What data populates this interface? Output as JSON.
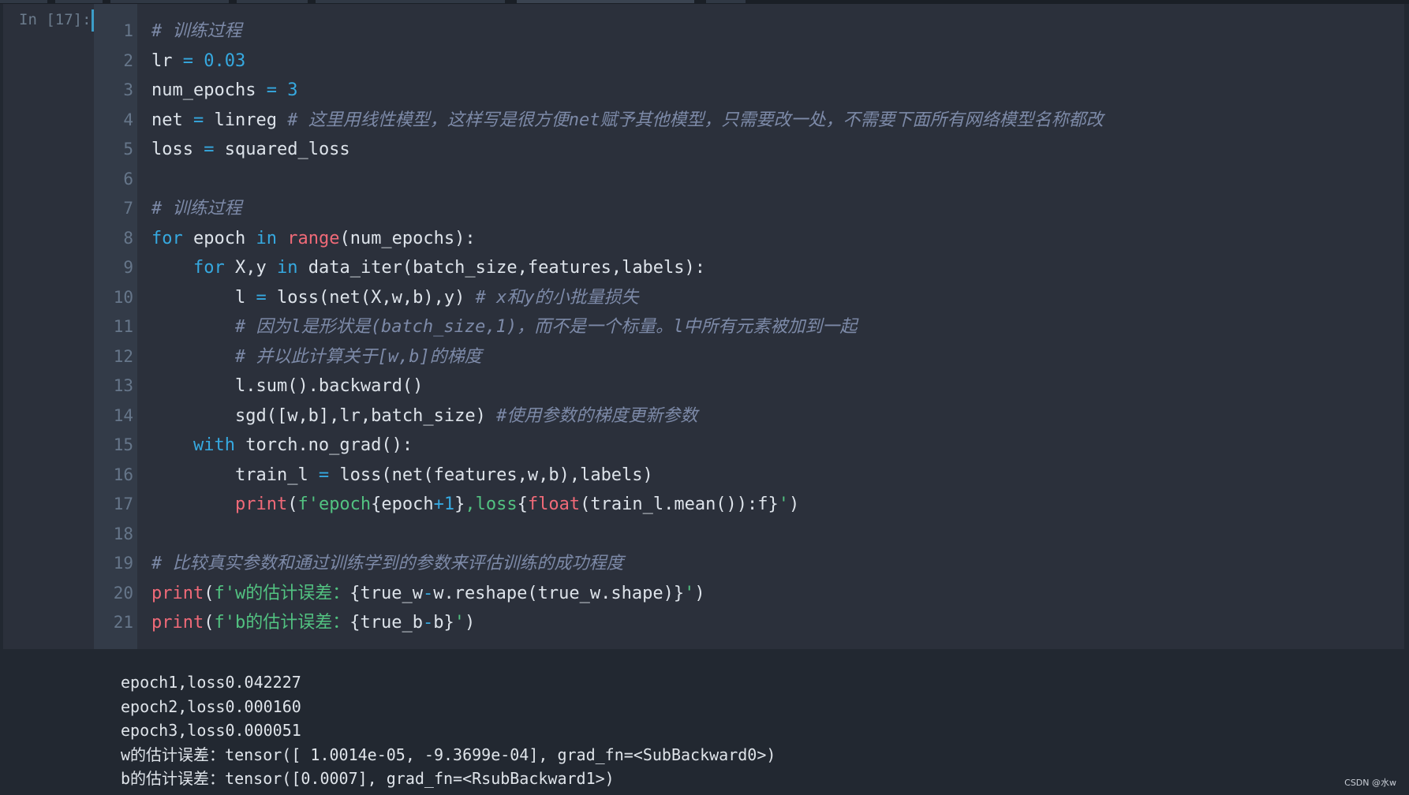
{
  "prompt": "In [17]:",
  "line_numbers": [
    "1",
    "2",
    "3",
    "4",
    "5",
    "6",
    "7",
    "8",
    "9",
    "10",
    "11",
    "12",
    "13",
    "14",
    "15",
    "16",
    "17",
    "18",
    "19",
    "20",
    "21"
  ],
  "code": {
    "l1_comment": "# 训练过程",
    "l2_var": "lr",
    "l2_op": " = ",
    "l2_num": "0.03",
    "l3_var": "num_epochs",
    "l3_op": " = ",
    "l3_num": "3",
    "l4_var": "net",
    "l4_op": " = ",
    "l4_val": "linreg ",
    "l4_comment": "# 这里用线性模型，这样写是很方便net赋予其他模型，只需要改一处，不需要下面所有网络模型名称都改",
    "l5_var": "loss",
    "l5_op": " = ",
    "l5_val": "squared_loss",
    "l7_comment": "# 训练过程",
    "l8_for": "for",
    "l8_a": " epoch ",
    "l8_in": "in",
    "l8_sp": " ",
    "l8_range": "range",
    "l8_b": "(num_epochs):",
    "l9_indent": "    ",
    "l9_for": "for",
    "l9_a": " X,y ",
    "l9_in": "in",
    "l9_b": " data_iter(batch_size,features,labels):",
    "l10_indent": "        ",
    "l10_a": "l",
    "l10_op": " = ",
    "l10_b": "loss(net(X,w,b),y) ",
    "l10_comment": "# x和y的小批量损失",
    "l11_indent": "        ",
    "l11_comment": "# 因为l是形状是(batch_size,1)，而不是一个标量。l中所有元素被加到一起",
    "l12_indent": "        ",
    "l12_comment": "# 并以此计算关于[w,b]的梯度",
    "l13_indent": "        ",
    "l13_a": "l.sum().backward()",
    "l14_indent": "        ",
    "l14_a": "sgd([w,b],lr,batch_size) ",
    "l14_comment": "#使用参数的梯度更新参数",
    "l15_indent": "    ",
    "l15_with": "with",
    "l15_a": " torch.no_grad():",
    "l16_indent": "        ",
    "l16_a": "train_l",
    "l16_op": " = ",
    "l16_b": "loss(net(features,w,b),labels)",
    "l17_indent": "        ",
    "l17_print": "print",
    "l17_p": "(",
    "l17_s1": "f'epoch",
    "l17_b1": "{epoch",
    "l17_plus": "+",
    "l17_one": "1",
    "l17_b2": "}",
    "l17_s2": ",loss",
    "l17_b3": "{",
    "l17_float": "float",
    "l17_b4": "(train_l.mean()):f}",
    "l17_s3": "'",
    "l17_end": ")",
    "l19_comment": "# 比较真实参数和通过训练学到的参数来评估训练的成功程度",
    "l20_print": "print",
    "l20_p": "(",
    "l20_s1": "f'w的估计误差：",
    "l20_b1": "{true_w",
    "l20_minus": "-",
    "l20_b2": "w.reshape(true_w.shape)}",
    "l20_s2": "'",
    "l20_end": ")",
    "l21_print": "print",
    "l21_p": "(",
    "l21_s1": "f'b的估计误差：",
    "l21_b1": "{true_b",
    "l21_minus": "-",
    "l21_b2": "b}",
    "l21_s2": "'",
    "l21_end": ")"
  },
  "output": [
    "epoch1,loss0.042227",
    "epoch2,loss0.000160",
    "epoch3,loss0.000051",
    "w的估计误差：tensor([ 1.0014e-05, -9.3699e-04], grad_fn=<SubBackward0>)",
    "b的估计误差：tensor([0.0007], grad_fn=<RsubBackward1>)"
  ],
  "watermark": "CSDN @水w",
  "colors": {
    "background": "#2b303b",
    "keyword": "#36a9e0",
    "builtin": "#f06a78",
    "string": "#52c281",
    "comment": "#7d8aa8"
  }
}
